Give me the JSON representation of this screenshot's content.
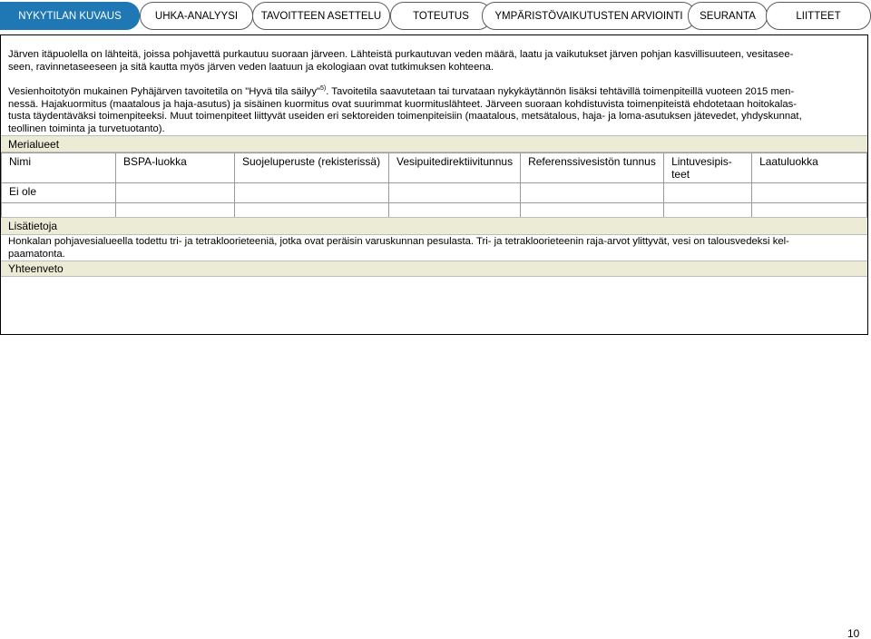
{
  "nav": {
    "tabs": [
      {
        "label": "NYKYTILAN KUVAUS",
        "active": true
      },
      {
        "label": "UHKA-ANALYYSI",
        "active": false
      },
      {
        "label": "TAVOITTEEN ASETTELU",
        "active": false
      },
      {
        "label": "TOTEUTUS",
        "active": false
      },
      {
        "label": "YMPÄRISTÖVAIKUTUSTEN ARVIOINTI",
        "active": false
      },
      {
        "label": "SEURANTA",
        "active": false
      },
      {
        "label": "LIITTEET",
        "active": false
      }
    ]
  },
  "content": {
    "para1_line1": "Järven itäpuolella on lähteitä, joissa pohjavettä purkautuu suoraan järveen. Lähteistä purkautuvan veden määrä, laatu ja vaikutukset järven pohjan kasvillisuuteen, vesitasee-",
    "para1_line2": "seen, ravinnetaseeseen ja sitä kautta myös järven veden laatuun ja ekologiaan ovat tutkimuksen kohteena.",
    "para2_line1_before": "Vesienhoitotyön mukainen Pyhäjärven tavoitetila on \"Hyvä tila säilyy\"",
    "para2_sup": "5)",
    "para2_line1_after": ". Tavoitetila saavutetaan tai turvataan nykykäytännön lisäksi tehtävillä toimenpiteillä vuoteen 2015 men-",
    "para2_line2": "nessä. Hajakuormitus (maatalous ja haja-asutus) ja sisäinen kuormitus ovat suurimmat kuormituslähteet. Järveen suoraan kohdistuvista toimenpiteistä ehdotetaan hoitokalas-",
    "para2_line3": "tusta täydentäväksi toimenpiteeksi. Muut toimenpiteet liittyvät useiden eri sektoreiden toimenpiteisiin (maatalous, metsätalous, haja- ja loma-asutuksen jätevedet, yhdyskunnat,",
    "para2_line4": "teollinen toiminta ja turvetuotanto)."
  },
  "sections": {
    "merialueet": "Merialueet",
    "lisatietoja": "Lisätietoja",
    "yhteenveto": "Yhteenveto"
  },
  "table": {
    "headers": [
      "Nimi",
      "BSPA-luokka",
      "Suojeluperuste (rekisterissä)",
      "Vesipuitedirektiivitunnus",
      "Referenssivesistön tunnus",
      "Lintuvesipis-teet",
      "Laatuluokka"
    ],
    "header_lintu_line1": "Lintuvesipis-",
    "header_lintu_line2": "teet",
    "row1": [
      "Ei ole",
      "",
      "",
      "",
      "",
      "",
      ""
    ],
    "row2": [
      "",
      "",
      "",
      "",
      "",
      "",
      ""
    ]
  },
  "info": {
    "line1": "Honkalan pohjavesialueella todettu tri- ja tetrakloorieteeniä, jotka ovat peräisin varuskunnan pesulasta. Tri- ja tetrakloorieteenin raja-arvot ylittyvät, vesi on talousvedeksi kel-",
    "line2": "paamatonta."
  },
  "footer": {
    "page_number": "10"
  }
}
